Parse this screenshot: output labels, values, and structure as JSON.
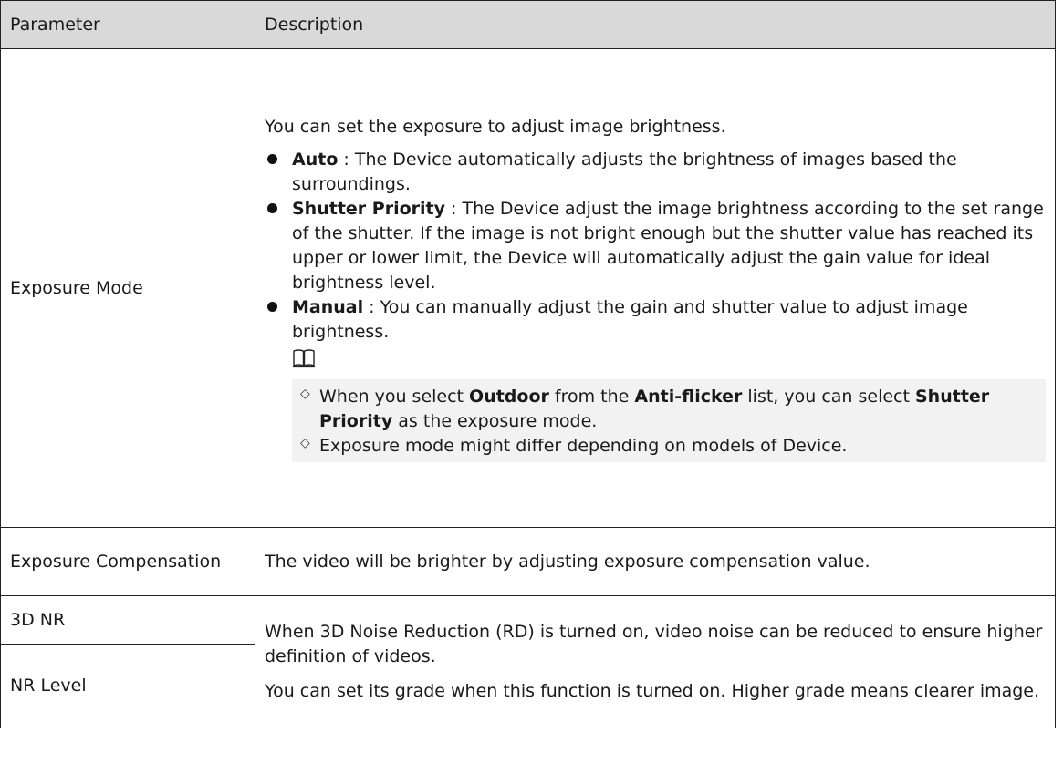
{
  "table": {
    "headers": {
      "parameter": "Parameter",
      "description": "Description"
    },
    "rows": {
      "exposure_mode": {
        "param": "Exposure Mode",
        "intro": "You can set the exposure to adjust image brightness.",
        "bullets": [
          {
            "term": "Auto",
            "text": " : The Device automatically adjusts the brightness of images based the surroundings."
          },
          {
            "term": "Shutter Priority",
            "text": " : The Device adjust the image brightness according to the set range of the shutter. If the image is not bright enough but the shutter value has reached its upper or lower limit, the Device will automatically adjust the gain value for ideal brightness level."
          },
          {
            "term": "Manual",
            "text": " : You can manually adjust the gain and shutter value to adjust image brightness."
          }
        ],
        "note_icon": "book-note-icon",
        "notes": {
          "n1_a": "When you select ",
          "n1_b": "Outdoor",
          "n1_c": "  from the ",
          "n1_d": "Anti-flicker",
          "n1_e": " list, you can select ",
          "n1_f": "Shutter Priority",
          "n1_g": " as the exposure mode.",
          "n2": "Exposure mode might differ depending on models of Device."
        }
      },
      "exposure_comp": {
        "param": "Exposure Compensation",
        "desc": "The video will be brighter by adjusting exposure compensation value."
      },
      "nr_3d": {
        "param": "3D NR"
      },
      "nr_level": {
        "param": "NR Level"
      },
      "merged_desc": {
        "p1": "When 3D Noise Reduction (RD) is turned on, video noise can be reduced to ensure higher definition of videos.",
        "p2": "You can set its grade when this function is turned on. Higher grade means clearer image."
      }
    }
  }
}
